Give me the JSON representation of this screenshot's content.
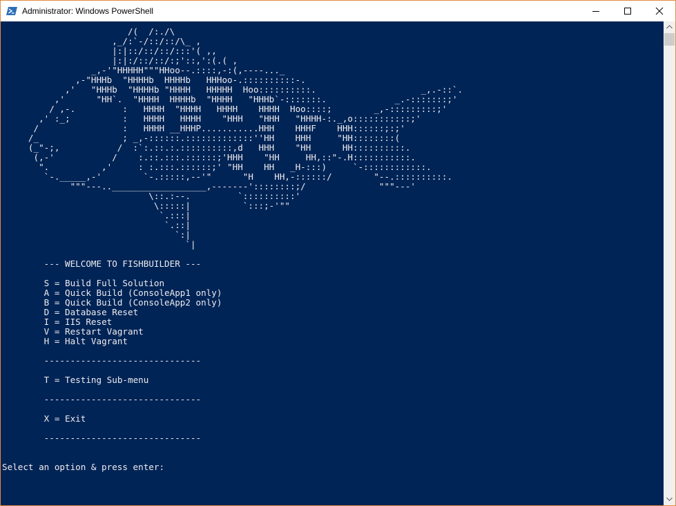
{
  "window": {
    "title": "Administrator: Windows PowerShell",
    "icons": {
      "app": "powershell-icon",
      "minimize": "minimize-icon",
      "maximize": "maximize-icon",
      "close": "close-icon"
    },
    "colors": {
      "console_bg": "#012456",
      "console_text": "#eeedf0",
      "title_bg": "#ffffff",
      "border": "#e08a3c"
    }
  },
  "console": {
    "fish_art": [
      "                        /(  /:./\\",
      "                     ,_/:`-/::/::/\\_ ,",
      "                     |:|::/::/::/:::'( ,,",
      "                     |:|:/::/::/:;'::,':(.( ,",
      "                 _,-'\"HHHHH\"\"\"HHoo--.::::,-:(,----..._",
      "              ,-\"HHHb  \"HHHHb  HHHHb   HHHoo-.::::::::::-.",
      "            ,'   \"HHHb  \"HHHHb \"HHHH   HHHHH  Hoo::::::::::.                    _,.-::`.",
      "          ,'      \"HH`.  \"HHHH  HHHHb  \"HHHH   \"HHHb`-:::::::.             _.-:::::::;'",
      "         / ,-.         :   HHHH  \"HHHH   HHHH    HHHH  Hoo::::;        _,-:::::::::;'",
      "       ,' :_;          :   HHHH   HHHH    \"HHH   \"HHH   \"HHHH-:._,o:::::::::::;'",
      "      /                :   HHHH __HHHP...........HHH    HHHF    HHH::::::;:;'",
      "     /_                ; _,-::::::.:::::::::::::''HH    HHH     \"HH::::::::(",
      "     (_\"-;,           /  :`:.::.:.::::::::::,d   HHH    \"HH      HH::::::::::.",
      "      (,-'           /    :.::.:::.::::::;'HHH    \"HH     HH,::\"-.H:::::::::::.",
      "       \".          ,'     : :.:::.::::::;' \"HH    HH   _H-:::)     `-::::::::::::.",
      "        `-._____,-'        `-.:::::,--'\"      \"H    HH,-::::::/        \"--.::::::::::.",
      "             \"\"\"---..__________________,-------'::::::::;/              \"\"\"---'",
      "                            \\::.:--.         `::::::::::'",
      "                             \\:::::|          `:::;-'\"\"",
      "                              `.:::|",
      "                               `.::|",
      "                                 `:|",
      "                                   `|"
    ],
    "menu": {
      "welcome": "--- WELCOME TO FISHBUILDER ---",
      "options": [
        "S = Build Full Solution",
        "A = Quick Build (ConsoleApp1 only)",
        "B = Quick Build (ConsoleApp2 only)",
        "D = Database Reset",
        "I = IIS Reset",
        "V = Restart Vagrant",
        "H = Halt Vagrant"
      ],
      "separator": "------------------------------",
      "testing": "T = Testing Sub-menu",
      "exit": "X = Exit"
    },
    "prompt": "Select an option & press enter:"
  }
}
